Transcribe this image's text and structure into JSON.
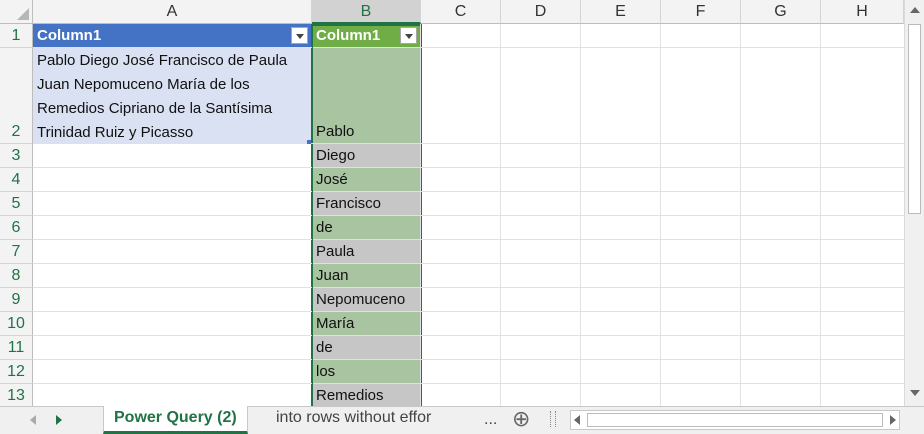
{
  "columns": [
    "A",
    "B",
    "C",
    "D",
    "E",
    "F",
    "G",
    "H"
  ],
  "rows": [
    "1",
    "2",
    "3",
    "4",
    "5",
    "6",
    "7",
    "8",
    "9",
    "10",
    "11",
    "12",
    "13"
  ],
  "table1": {
    "header": "Column1",
    "cell_text": "Pablo Diego José Francisco de Paula Juan Nepomuceno María de los Remedios Cipriano de la Santísima Trinidad Ruiz y Picasso"
  },
  "table2": {
    "header": "Column1",
    "values": [
      "Pablo",
      "Diego",
      "José",
      "Francisco",
      "de",
      "Paula",
      "Juan",
      "Nepomuceno",
      "María",
      "de",
      "los",
      "Remedios"
    ]
  },
  "sheet_tabs": {
    "active": "Power Query (2)",
    "other": "into rows without effor",
    "more": "...",
    "add_icon": "⊕"
  },
  "colors": {
    "accent": "#217346",
    "table1_header": "#4472c4",
    "table2_header": "#70ad47"
  }
}
